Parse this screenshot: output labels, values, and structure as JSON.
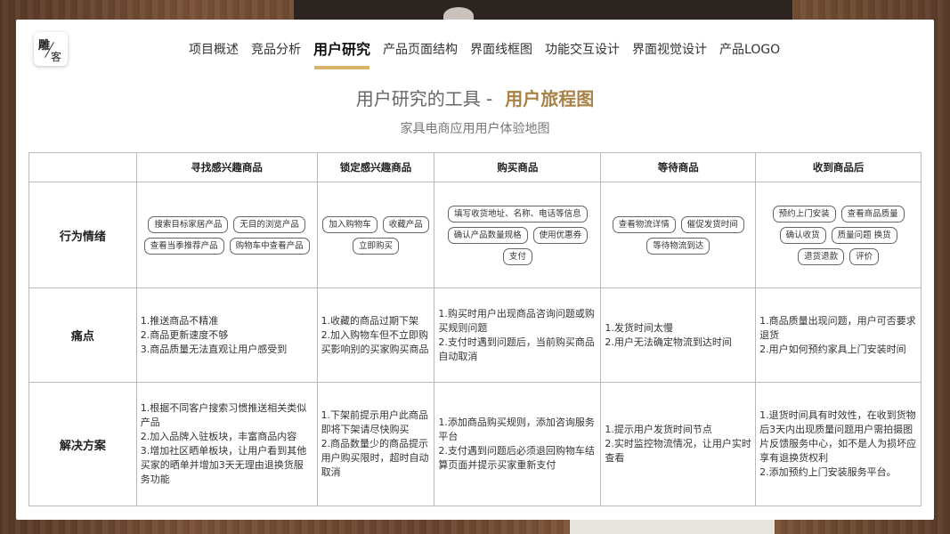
{
  "logo": {
    "char1": "雕",
    "char2": "客"
  },
  "nav": [
    {
      "label": "项目概述",
      "active": false
    },
    {
      "label": "竞品分析",
      "active": false
    },
    {
      "label": "用户研究",
      "active": true
    },
    {
      "label": "产品页面结构",
      "active": false
    },
    {
      "label": "界面线框图",
      "active": false
    },
    {
      "label": "功能交互设计",
      "active": false
    },
    {
      "label": "界面视觉设计",
      "active": false
    },
    {
      "label": "产品LOGO",
      "active": false
    }
  ],
  "title": {
    "prefix": "用户研究的工具 -",
    "accent": "用户旅程图"
  },
  "subtitle": "家具电商应用用户体验地图",
  "table": {
    "headers": [
      "",
      "寻找感兴趣商品",
      "锁定感兴趣商品",
      "购买商品",
      "等待商品",
      "收到商品后"
    ],
    "rows": {
      "behavior": {
        "label": "行为情绪",
        "cells": [
          [
            "搜索目标家居产品",
            "无目的浏览产品",
            "查看当季推荐产品",
            "购物车中查看产品"
          ],
          [
            "加入购物车",
            "收藏产品",
            "立即购买"
          ],
          [
            "填写收货地址、名称、电话等信息",
            "确认产品数量规格",
            "使用优惠券",
            "支付"
          ],
          [
            "查看物流详情",
            "催促发货时间",
            "等待物流到达"
          ],
          [
            "预约上门安装",
            "查看商品质量",
            "确认收货",
            "质量问题 换货",
            "退货退款",
            "评价"
          ]
        ]
      },
      "pain": {
        "label": "痛点",
        "cells": [
          [
            "1.推送商品不精准",
            "2.商品更新速度不够",
            "3.商品质量无法直观让用户感受到"
          ],
          [
            "1.收藏的商品过期下架",
            "2.加入购物车但不立即购买影响别的买家购买商品"
          ],
          [
            "1.购买时用户出现商品咨询问题或购买规则问题",
            "2.支付时遇到问题后，当前购买商品自动取消"
          ],
          [
            "1.发货时间太慢",
            "2.用户无法确定物流到达时间"
          ],
          [
            "1.商品质量出现问题，用户可否要求退货",
            "2.用户如何预约家具上门安装时间"
          ]
        ]
      },
      "solution": {
        "label": "解决方案",
        "cells": [
          [
            "1.根据不同客户搜索习惯推送相关类似产品",
            "2.加入品牌入驻板块，丰富商品内容",
            "3.增加社区晒单板块，让用户看到其他买家的晒单并增加3天无理由退换货服务功能"
          ],
          [
            "1.下架前提示用户此商品即将下架请尽快购买",
            "2.商品数量少的商品提示用户购买限时，超时自动取消"
          ],
          [
            "1.添加商品购买规则，添加咨询服务平台",
            "2.支付遇到问题后必须退回购物车结算页面并提示买家重新支付"
          ],
          [
            "1.提示用户发货时间节点",
            "2.实时监控物流情况，让用户实时查看"
          ],
          [
            "1.退货时间具有时效性，在收到货物后3天内出现质量问题用户需拍摄图片反馈服务中心，如不是人为损坏应享有退换货权利",
            "2.添加预约上门安装服务平台。"
          ]
        ]
      }
    }
  }
}
